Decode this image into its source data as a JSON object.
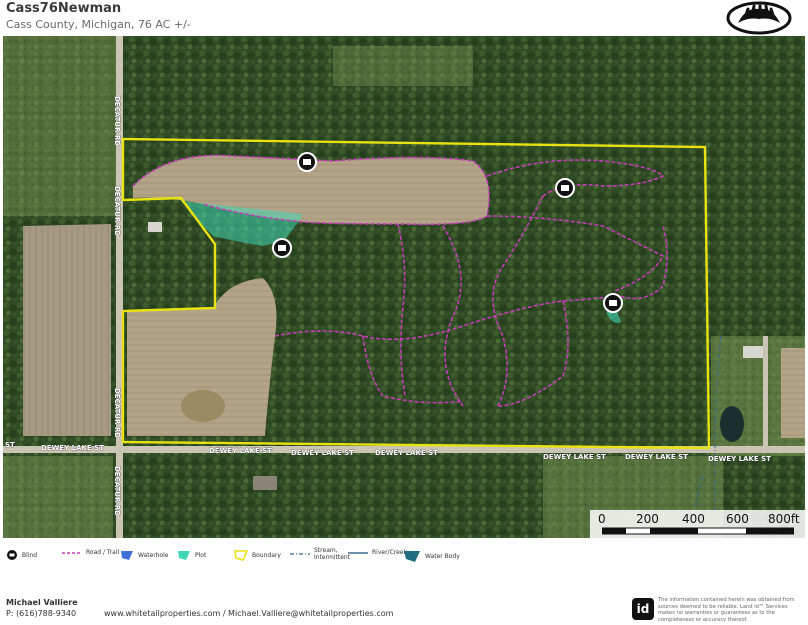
{
  "header": {
    "title": "Cass76Newman",
    "subtitle": "Cass County, Michigan, 76 AC +/-"
  },
  "map": {
    "road_labels": {
      "decatur": "DECATUR RD",
      "dewey": "DEWEY LAKE ST",
      "dewey_short": "ST"
    },
    "scale": {
      "ticks": [
        "0",
        "200",
        "400",
        "600",
        "800ft"
      ]
    },
    "colors": {
      "boundary": "#e8e212",
      "trail": "#c23fb4",
      "plot": "#3fd7b5",
      "water_body": "#1d6f80",
      "waterhole": "#3f6fd7"
    }
  },
  "legend": {
    "items": [
      {
        "label": "Blind",
        "icon": "blind-icon"
      },
      {
        "label": "Road / Trail",
        "icon": "trail-line-icon"
      },
      {
        "label": "Waterhole",
        "icon": "waterhole-icon"
      },
      {
        "label": "Plot",
        "icon": "plot-icon"
      },
      {
        "label": "Boundary",
        "icon": "boundary-icon"
      },
      {
        "label": "Stream, Intermittent",
        "icon": "stream-intermittent-icon"
      },
      {
        "label": "River/Creek",
        "icon": "river-creek-icon"
      },
      {
        "label": "Water Body",
        "icon": "water-body-icon"
      }
    ]
  },
  "footer": {
    "agent_name": "Michael Valliere",
    "phone": "P: (616)788-9340",
    "web": "www.whitetailproperties.com / Michael.Valliere@whitetailproperties.com",
    "badge": "id",
    "disclaimer": "The information contained herein was obtained from sources deemed to be reliable. Land id™ Services makes no warranties or guarantees as to the completeness or accuracy thereof."
  }
}
